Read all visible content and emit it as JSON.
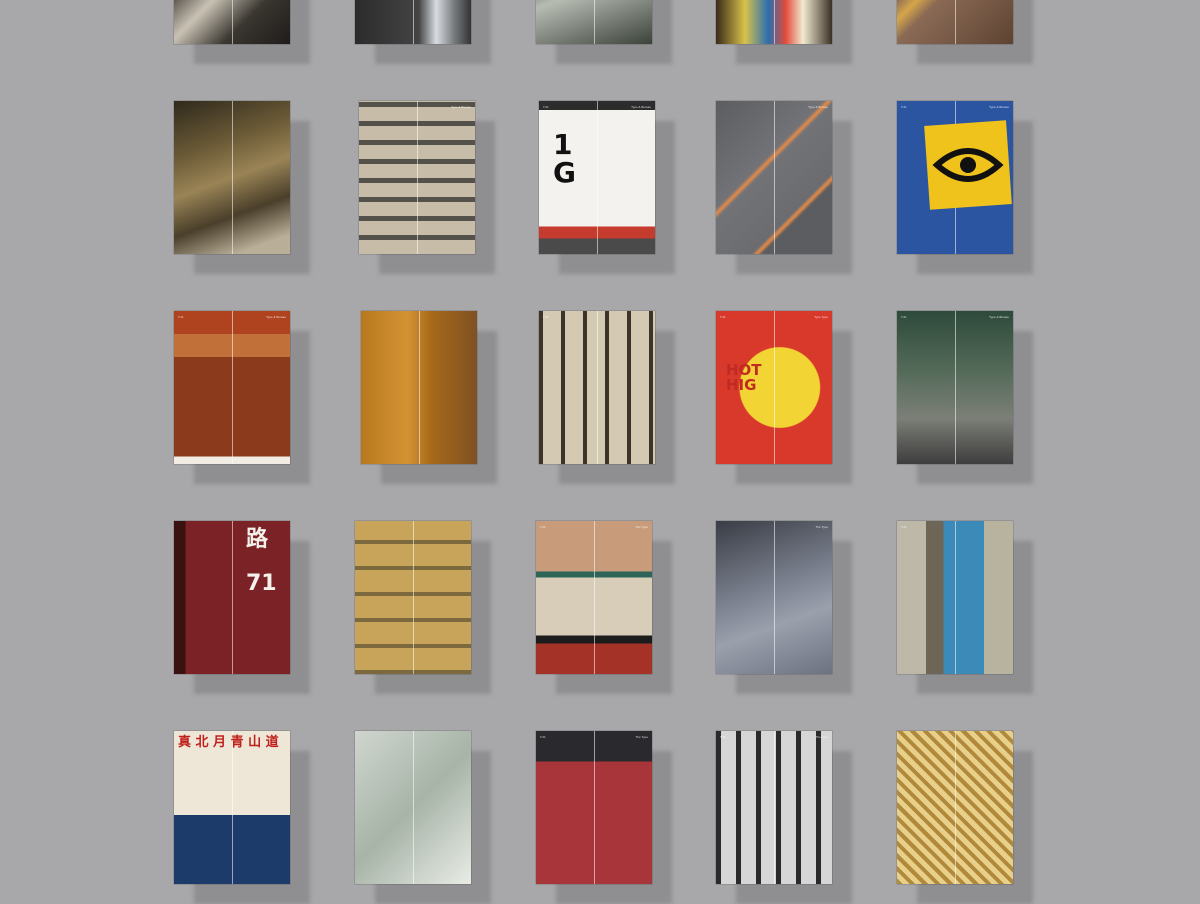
{
  "posters": [
    {
      "name": "poster-ornate-carving",
      "row": 0,
      "col": 0,
      "bg": "linear-gradient(135deg,#2d2a26,#5c5650 40%,#c9c2b4 55%,#3a3630 75%,#1e1c1a)",
      "text": "",
      "hdr": [
        "",
        ""
      ]
    },
    {
      "name": "poster-building-window-person",
      "row": 0,
      "col": 1,
      "bg": "linear-gradient(90deg,#2b2b2b,#444 55%,#d8dde2 70%,#7a7d80 85%,#333)",
      "text": "",
      "hdr": [
        "",
        ""
      ]
    },
    {
      "name": "poster-press-machine",
      "row": 0,
      "col": 2,
      "bg": "linear-gradient(160deg,#1f2420,#4d554c 40%,#b7bcb3 60%,#3b423a)",
      "text": "",
      "hdr": [
        "",
        ""
      ]
    },
    {
      "name": "poster-signs-stall",
      "row": 0,
      "col": 3,
      "bg": "linear-gradient(90deg,#3a2a1a,#d8c24a 25%,#2a6fb0 45%,#e24a3a 60%,#f0ead0 75%,#3b3025)",
      "text": "",
      "hdr": [
        "",
        ""
      ]
    },
    {
      "name": "poster-painted-floor-lines",
      "row": 0,
      "col": 4,
      "bg": "linear-gradient(135deg,#6e4f3c,#8a6a55 40%,#d6a64a 48%,#8a6a55 56%,#5e4332)",
      "text": "",
      "hdr": [
        "",
        ""
      ]
    },
    {
      "name": "poster-tools-workbench",
      "row": 1,
      "col": 0,
      "bg": "linear-gradient(160deg,#2f2a1d,#6b5a36 30%,#9a8456 50%,#4a3f2a 70%,#b9ae98 90%)",
      "text": "",
      "hdr": [
        "",
        ""
      ]
    },
    {
      "name": "poster-facade-windows",
      "row": 1,
      "col": 1,
      "bg": "repeating-linear-gradient(0deg,#c7bca7 0 14px,#54504a 14px 19px),linear-gradient(#d9dcdf,#c7bca7)",
      "text": "",
      "hdr": [
        "",
        "Type & Bureau"
      ]
    },
    {
      "name": "poster-1g-sign",
      "row": 1,
      "col": 2,
      "bg": "linear-gradient(180deg,#2c2c2c 0 6%,#f4f2ee 6% 82%,#c53b2d 82% 90%,#4a4a4a 90%)",
      "text": "1\nG",
      "textColor": "#111",
      "textSize": "28px",
      "textLeft": "14px",
      "textTop": "30px",
      "hdr": [
        "T.21",
        "Type & Bureau"
      ]
    },
    {
      "name": "poster-hopscotch-numbers",
      "row": 1,
      "col": 3,
      "bg": "linear-gradient(135deg,#5c5d60,#727377 40%,#e48a47 42%,#727377 44%,#6b6c70 70%,#e48a47 72%,#5c5d60 74%)",
      "text": "",
      "hdr": [
        "",
        "Type & Bureau"
      ]
    },
    {
      "name": "poster-eye-sign",
      "row": 1,
      "col": 4,
      "bg": "#2b55a0",
      "text": "",
      "eye": true,
      "hdr": [
        "T.21",
        "Type & Bureau"
      ]
    },
    {
      "name": "poster-carved-wood-panel",
      "row": 2,
      "col": 0,
      "bg": "linear-gradient(180deg,#b0431f 0 15%,#c07038 15% 30%,#8b3a1c 30% 95%,#f1ece4 95%)",
      "text": "",
      "hdr": [
        "T.21",
        "Type & Bureau"
      ]
    },
    {
      "name": "poster-wall-workers",
      "row": 2,
      "col": 1,
      "bg": "linear-gradient(90deg,#b8781e,#d39334 40%,#a86a1a 60%,#7f5022)",
      "text": "",
      "hdr": [
        "",
        ""
      ]
    },
    {
      "name": "poster-calligraphy-wall",
      "row": 2,
      "col": 2,
      "bg": "repeating-linear-gradient(90deg,#3c3428 0 4px,#d4cab3 4px 22px),linear-gradient(#3c3428,#2a241c)",
      "text": "",
      "hdr": [
        "T.21",
        ""
      ]
    },
    {
      "name": "poster-hot-highway-mural",
      "row": 2,
      "col": 3,
      "bg": "radial-gradient(circle at 55% 50%,#f2d534 0 40%,#d8392b 41%)",
      "text": "HOT\nHIG",
      "textColor": "#c02a22",
      "textSize": "15px",
      "textLeft": "10px",
      "textTop": "52px",
      "hdr": [
        "T.21",
        "Type Type"
      ]
    },
    {
      "name": "poster-neon-street",
      "row": 2,
      "col": 4,
      "bg": "linear-gradient(180deg,#2e4a3a,#556b5a 40%,#7c7f77 70%,#3e3e3e)",
      "text": "",
      "hdr": [
        "T.21",
        "Type & Bureau"
      ]
    },
    {
      "name": "poster-road-markings",
      "row": 3,
      "col": 0,
      "bg": "linear-gradient(90deg,#3a1010 0 10%,#7a2226 10% 100%)",
      "text": "路\n\n71",
      "textColor": "#f4f0ea",
      "textSize": "22px",
      "textLeft": "72px",
      "textTop": "8px",
      "hdr": [
        "",
        ""
      ]
    },
    {
      "name": "poster-product-shelves",
      "row": 3,
      "col": 1,
      "bg": "repeating-linear-gradient(0deg,#7c6a3e 0 4px,#c8a45a 4px 26px),linear-gradient(#a0302a,#c8a45a)",
      "text": "",
      "hdr": [
        "",
        ""
      ]
    },
    {
      "name": "poster-tile-patterns",
      "row": 3,
      "col": 2,
      "bg": "linear-gradient(180deg,#c89c7b 0 33%,#2d6659 33% 37%,#d8cdb9 37% 75%,#1c1c1c 75% 80%,#a43226 80%)",
      "text": "",
      "hdr": [
        "T.21",
        "The Type"
      ]
    },
    {
      "name": "poster-ground-calligraphy",
      "row": 3,
      "col": 3,
      "bg": "linear-gradient(160deg,#3a3d45,#7c8290 45%,#9aa0ac 65%,#6c7280)",
      "text": "",
      "hdr": [
        "",
        "The Type"
      ]
    },
    {
      "name": "poster-graffiti-door",
      "row": 3,
      "col": 4,
      "bg": "linear-gradient(90deg,#bdb8a8 0 25%,#6d6656 25% 40%,#3c8ab8 40% 75%,#b8b39f 75%)",
      "text": "",
      "hdr": [
        "T.21",
        ""
      ]
    },
    {
      "name": "poster-shop-signs",
      "row": 4,
      "col": 0,
      "bg": "linear-gradient(180deg,#eee6d6 0 55%,#1c3a6a 55%)",
      "text": "真 北 月 青 山 道",
      "textColor": "#c0201b",
      "textSize": "13px",
      "textLeft": "4px",
      "textTop": "5px",
      "hdr": [
        "",
        ""
      ]
    },
    {
      "name": "poster-foliage",
      "row": 4,
      "col": 1,
      "bg": "linear-gradient(135deg,#cfd6cf,#a8b4a8 50%,#e8ece6)",
      "text": "",
      "hdr": [
        "",
        ""
      ]
    },
    {
      "name": "poster-red-light",
      "row": 4,
      "col": 2,
      "bg": "linear-gradient(180deg,#2a2a2e 0 20%,#a8353a 20%)",
      "text": "",
      "hdr": [
        "T.21",
        "The Type"
      ]
    },
    {
      "name": "poster-monochrome-frames",
      "row": 4,
      "col": 3,
      "bg": "repeating-linear-gradient(90deg,#2a2a2a 0 5px,#d6d6d6 5px 20px)",
      "text": "",
      "hdr": [
        "T.21",
        "The Type"
      ]
    },
    {
      "name": "poster-gold-lattice",
      "row": 4,
      "col": 4,
      "bg": "repeating-linear-gradient(45deg,#b08a3a 0 4px,#e8cf8a 4px 9px)",
      "text": "",
      "hdr": [
        "",
        ""
      ]
    }
  ]
}
